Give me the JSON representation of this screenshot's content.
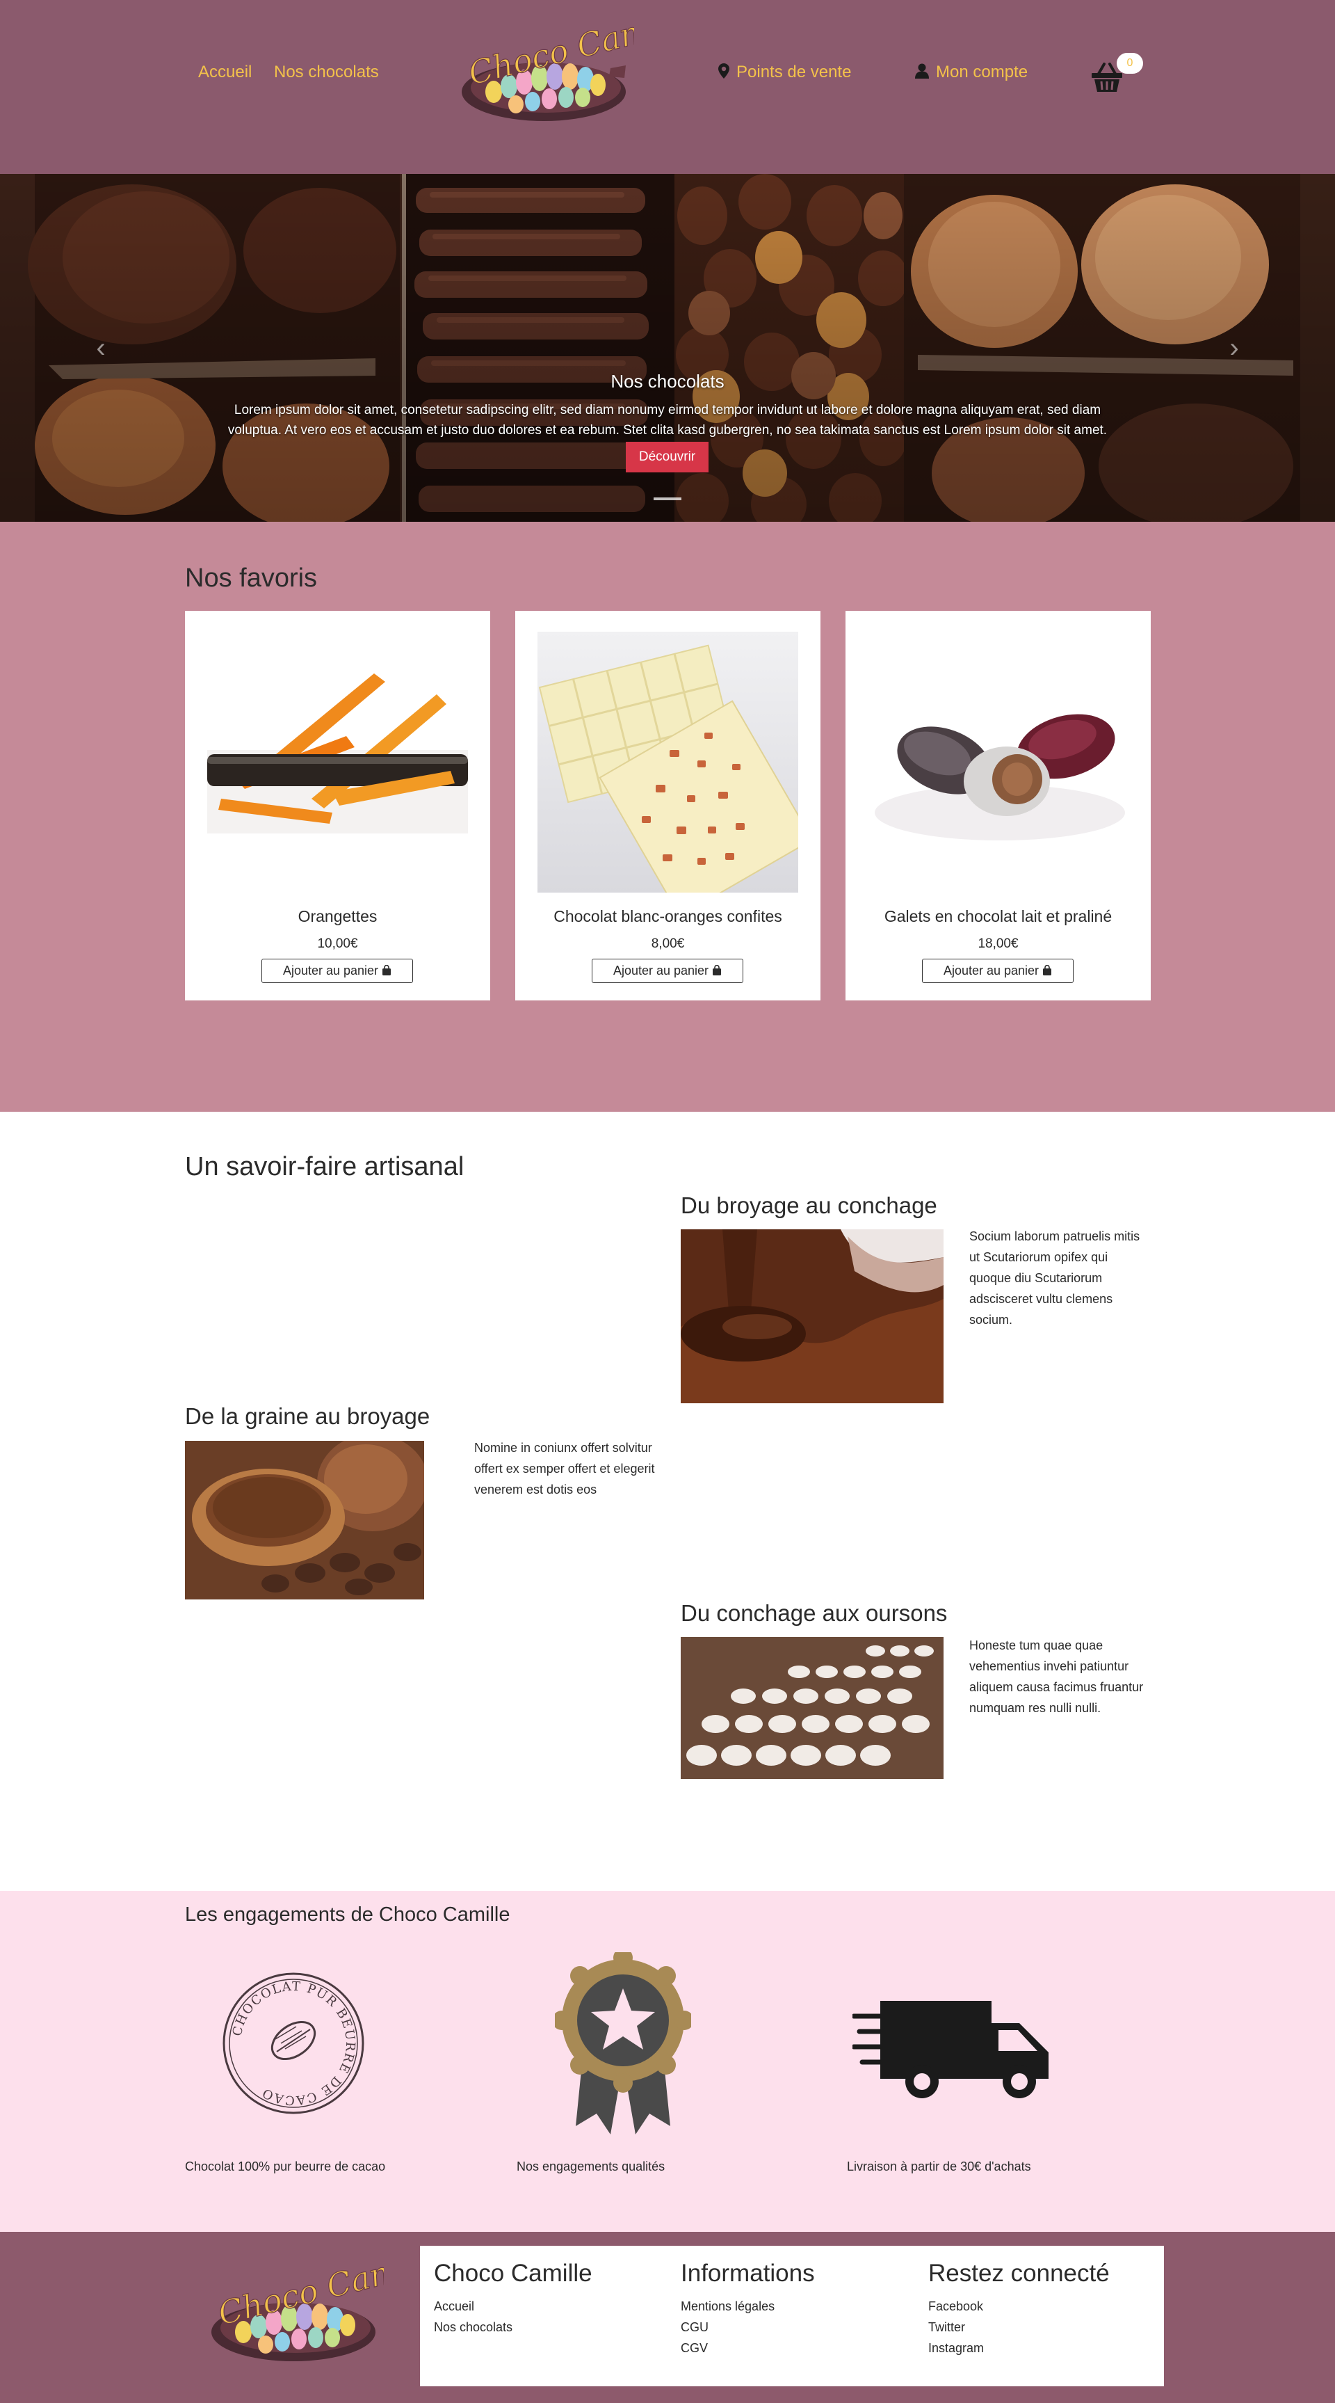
{
  "header": {
    "nav": [
      {
        "label": "Accueil"
      },
      {
        "label": "Nos chocolats"
      }
    ],
    "logo_text": "Choco Camille",
    "points_de_vente": "Points de vente",
    "mon_compte": "Mon compte",
    "cart_count": "0",
    "accent_color": "#f3c24a",
    "bg_color": "#8b5a6d"
  },
  "hero": {
    "title": "Nos chocolats",
    "text": "Lorem ipsum dolor sit amet, consetetur sadipscing elitr, sed diam nonumy eirmod tempor invidunt ut labore et dolore magna aliquyam erat, sed diam voluptua. At vero eos et accusam et justo duo dolores et ea rebum. Stet clita kasd gubergren, no sea takimata sanctus est Lorem ipsum dolor sit amet.",
    "button": "Découvrir",
    "button_color": "#d73648"
  },
  "favorites": {
    "title": "Nos favoris",
    "products": [
      {
        "name": "Orangettes",
        "price": "10,00€",
        "button": "Ajouter au panier"
      },
      {
        "name": "Chocolat blanc-oranges confites",
        "price": "8,00€",
        "button": "Ajouter au panier"
      },
      {
        "name": "Galets en chocolat lait et praliné",
        "price": "18,00€",
        "button": "Ajouter au panier"
      }
    ],
    "bg_color": "#c58a98"
  },
  "savoir": {
    "title": "Un savoir-faire artisanal",
    "steps": [
      {
        "title": "Du broyage au conchage",
        "text": "Socium laborum patruelis mitis ut Scutariorum opifex qui quoque diu Scutariorum adscisceret vultu clemens socium."
      },
      {
        "title": "De la graine au broyage",
        "text": "Nomine in coniunx offert solvitur offert ex semper offert et elegerit venerem est dotis eos"
      },
      {
        "title": "Du conchage aux oursons",
        "text": "Honeste tum quae quae vehementius invehi patiuntur aliquem causa facimus fruantur numquam res nulli nulli."
      }
    ]
  },
  "engagements": {
    "title": "Les engagements de Choco Camille",
    "items": [
      {
        "label": "Chocolat 100% pur beurre de cacao",
        "badge_text": "CHOCOLAT PUR BEURRE DE CACAO"
      },
      {
        "label": "Nos engagements qualités"
      },
      {
        "label": "Livraison à partir de 30€ d'achats"
      }
    ],
    "bg_color": "#fde0ec"
  },
  "footer": {
    "columns": [
      {
        "title": "Choco Camille",
        "links": [
          "Accueil",
          "Nos chocolats"
        ]
      },
      {
        "title": "Informations",
        "links": [
          "Mentions légales",
          "CGU",
          "CGV"
        ]
      },
      {
        "title": "Restez connecté",
        "links": [
          "Facebook",
          "Twitter",
          "Instagram"
        ]
      }
    ]
  }
}
